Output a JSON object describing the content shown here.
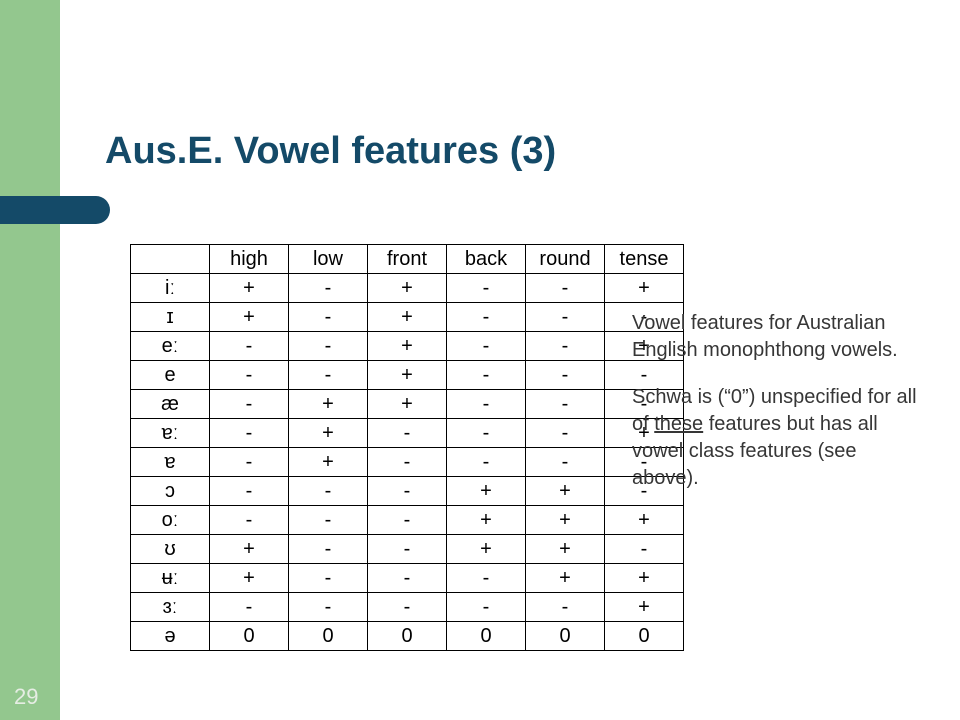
{
  "slide": {
    "title": "Aus.E. Vowel features (3)",
    "number": "29"
  },
  "table": {
    "columns": [
      "high",
      "low",
      "front",
      "back",
      "round",
      "tense"
    ],
    "rows": [
      {
        "label": "iː",
        "values": [
          "+",
          "-",
          "+",
          "-",
          "-",
          "+"
        ]
      },
      {
        "label": "ɪ",
        "values": [
          "+",
          "-",
          "+",
          "-",
          "-",
          "-"
        ]
      },
      {
        "label": "eː",
        "values": [
          "-",
          "-",
          "+",
          "-",
          "-",
          "+"
        ]
      },
      {
        "label": "e",
        "values": [
          "-",
          "-",
          "+",
          "-",
          "-",
          "-"
        ]
      },
      {
        "label": "æ",
        "values": [
          "-",
          "+",
          "+",
          "-",
          "-",
          "-"
        ]
      },
      {
        "label": "ɐː",
        "values": [
          "-",
          "+",
          "-",
          "-",
          "-",
          "+"
        ]
      },
      {
        "label": "ɐ",
        "values": [
          "-",
          "+",
          "-",
          "-",
          "-",
          "-"
        ]
      },
      {
        "label": "ɔ",
        "values": [
          "-",
          "-",
          "-",
          "+",
          "+",
          "-"
        ]
      },
      {
        "label": "oː",
        "values": [
          "-",
          "-",
          "-",
          "+",
          "+",
          "+"
        ]
      },
      {
        "label": "ʊ",
        "values": [
          "+",
          "-",
          "-",
          "+",
          "+",
          "-"
        ]
      },
      {
        "label": "ʉː",
        "values": [
          "+",
          "-",
          "-",
          "-",
          "+",
          "+"
        ]
      },
      {
        "label": "ɜː",
        "values": [
          "-",
          "-",
          "-",
          "-",
          "-",
          "+"
        ]
      },
      {
        "label": "ə",
        "values": [
          "0",
          "0",
          "0",
          "0",
          "0",
          "0"
        ]
      }
    ]
  },
  "side": {
    "p1": "Vowel features for Australian English monophthong vowels.",
    "p2a": "Schwa is (“0”) unspecified for all of ",
    "p2_ul": "these",
    "p2b": " features but has all vowel class features (see above)."
  }
}
